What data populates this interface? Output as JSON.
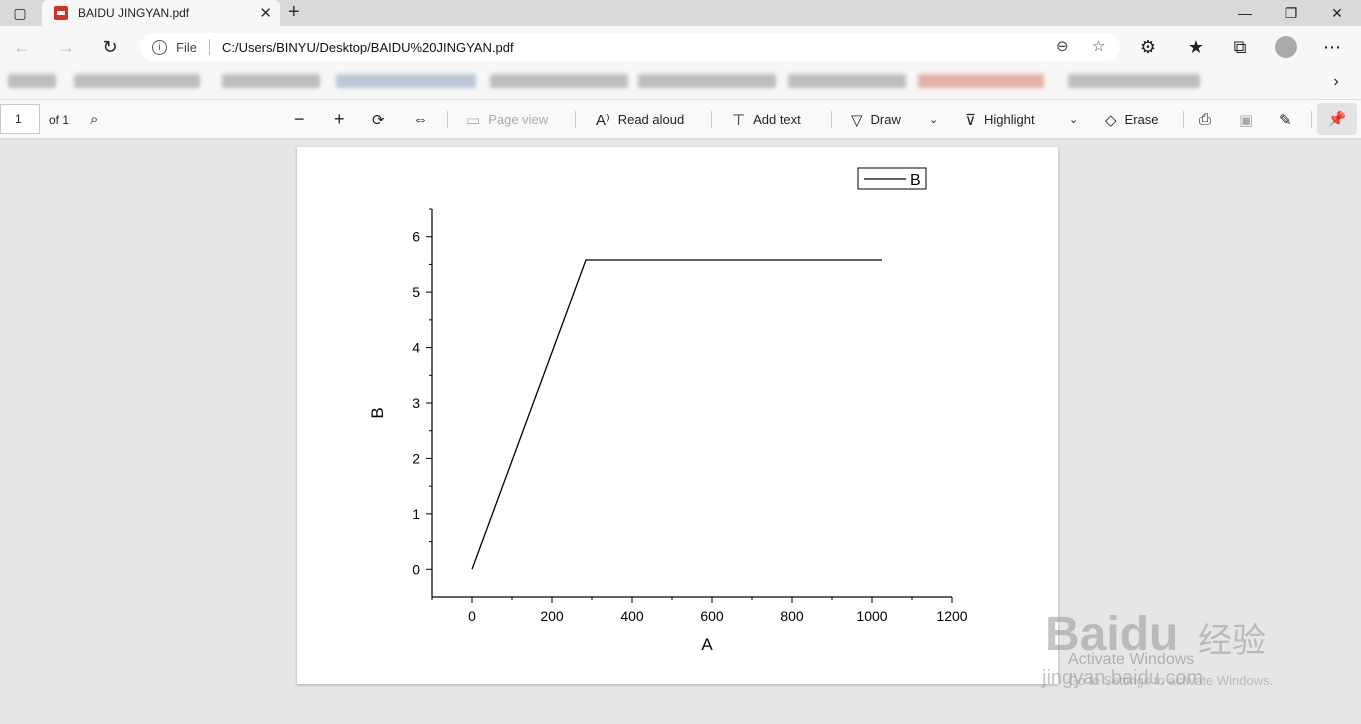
{
  "browser": {
    "tab_title": "BAIDU JINGYAN.pdf",
    "address_scheme": "File",
    "address_url": "C:/Users/BINYU/Desktop/BAIDU%20JINGYAN.pdf"
  },
  "pdf_toolbar": {
    "page_number": "1",
    "page_count": "of 1",
    "page_view": "Page view",
    "read_aloud": "Read aloud",
    "add_text": "Add text",
    "draw": "Draw",
    "highlight": "Highlight",
    "erase": "Erase"
  },
  "chart_data": {
    "type": "line",
    "xlabel": "A",
    "ylabel": "B",
    "xlim": [
      -100,
      1200
    ],
    "ylim": [
      -0.5,
      6.5
    ],
    "xticks": [
      0,
      200,
      400,
      600,
      800,
      1000,
      1200
    ],
    "yticks": [
      0,
      1,
      2,
      3,
      4,
      5,
      6
    ],
    "legend": "top-right",
    "series": [
      {
        "name": "B",
        "x": [
          0,
          285,
          1025
        ],
        "y": [
          0,
          5.58,
          5.58
        ],
        "color": "#000000"
      }
    ]
  },
  "watermark": {
    "brand": "Baidu",
    "brand_cn": "经验",
    "url": "jingyan.baidu.com"
  },
  "os_notice": {
    "line1": "Activate Windows",
    "line2": "Go to Settings to activate Windows."
  }
}
